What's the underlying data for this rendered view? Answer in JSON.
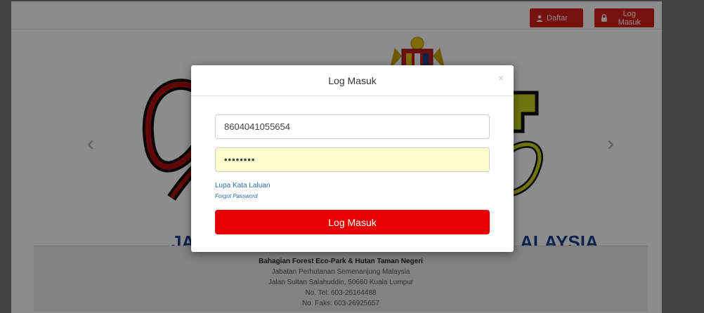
{
  "nav": {
    "register_label": "Daftar",
    "login_label": "Log Masuk"
  },
  "banner": {
    "text_left": "JA",
    "text_right": "ALAYSIA"
  },
  "footer": {
    "lines": [
      "Bahagian Forest Eco-Park & Hutan Taman Negeri",
      "Jabatan Perhutanan Semenanjung Malaysia",
      "Jalan Sultan Salahuddin, 50660 Kuala Lumpur",
      "No. Tel: 603-26164488",
      "No. Faks: 603-26925657"
    ]
  },
  "modal": {
    "title": "Log Masuk",
    "close_glyph": "×",
    "username_value": "8604041055654",
    "password_mask": "••••••••",
    "forgot_label": "Lupa Kata Laluan",
    "forgot_label_en": "Forgot Password",
    "submit_label": "Log Masuk"
  },
  "colors": {
    "accent_red": "#e60000",
    "nav_red": "#d9201a",
    "link_blue": "#2a6ab0",
    "autofill_yellow": "#fbfbd0"
  }
}
